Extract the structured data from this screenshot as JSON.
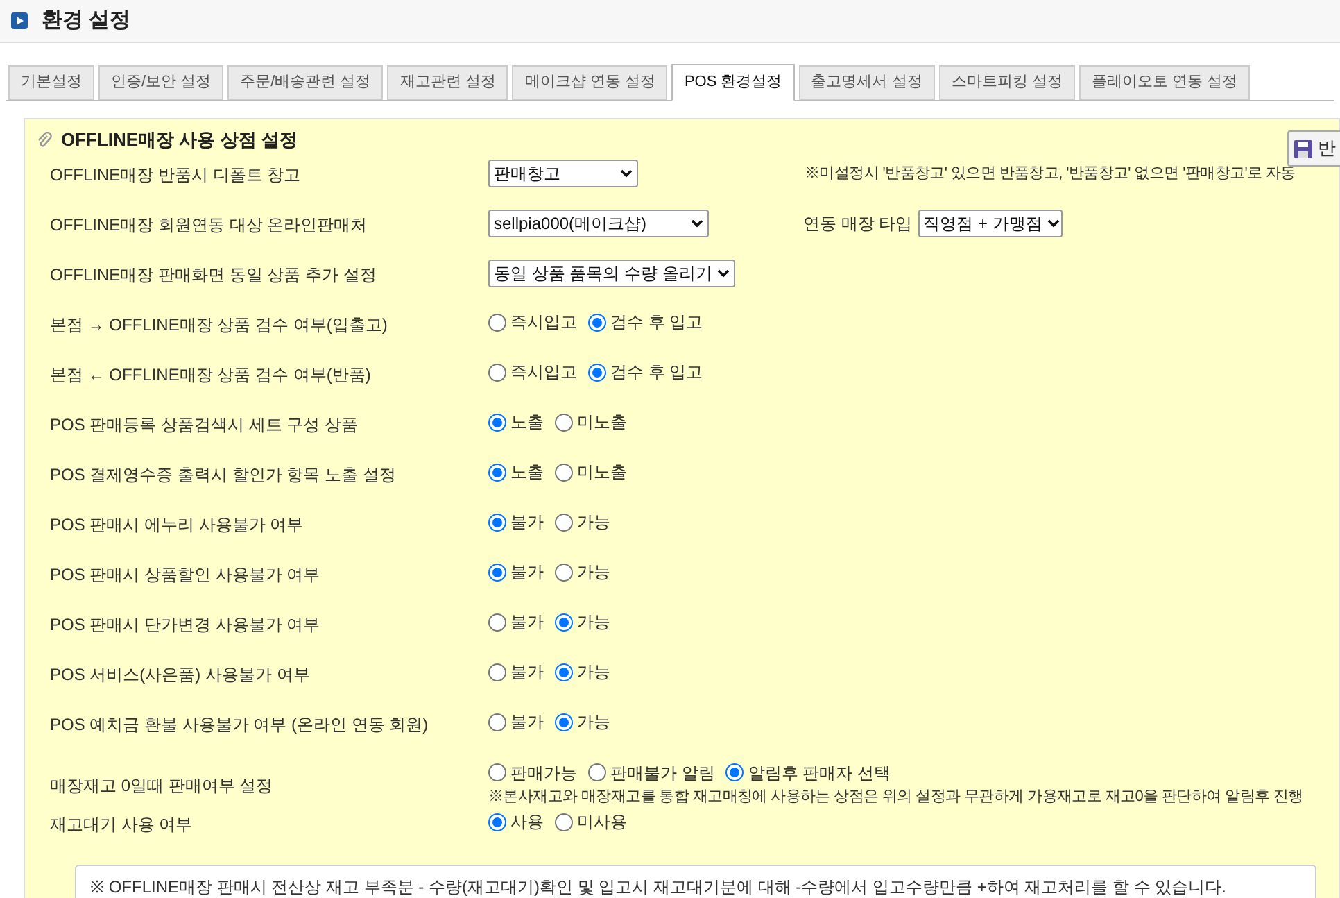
{
  "page_title": "환경 설정",
  "tabs": [
    {
      "label": "기본설정",
      "selected": false
    },
    {
      "label": "인증/보안 설정",
      "selected": false
    },
    {
      "label": "주문/배송관련 설정",
      "selected": false
    },
    {
      "label": "재고관련 설정",
      "selected": false
    },
    {
      "label": "메이크샵 연동 설정",
      "selected": false
    },
    {
      "label": "POS 환경설정",
      "selected": true
    },
    {
      "label": "출고명세서 설정",
      "selected": false
    },
    {
      "label": "스마트피킹 설정",
      "selected": false
    },
    {
      "label": "플레이오토 연동 설정",
      "selected": false
    }
  ],
  "panel": {
    "title": "OFFLINE매장 사용 상점 설정",
    "save_button": "반"
  },
  "settings": [
    {
      "kind": "select",
      "label": "OFFLINE매장 반품시 디폴트 창고",
      "value": "판매창고",
      "note": "※미설정시 '반품창고' 있으면 반품창고, '반품창고' 없으면 '판매창고'로 자동"
    },
    {
      "kind": "select",
      "label": "OFFLINE매장 회원연동 대상 온라인판매처",
      "value": "sellpia000(메이크샵)",
      "extra_label": "연동 매장 타입",
      "extra_value": "직영점 + 가맹점"
    },
    {
      "kind": "select",
      "label": "OFFLINE매장 판매화면 동일 상품 추가 설정",
      "value": "동일 상품 품목의 수량 올리기"
    },
    {
      "kind": "radio",
      "label": "본점 → OFFLINE매장 상품 검수 여부(입출고)",
      "options": [
        {
          "label": "즉시입고",
          "selected": false
        },
        {
          "label": "검수 후 입고",
          "selected": true
        }
      ]
    },
    {
      "kind": "radio",
      "label": "본점 ← OFFLINE매장 상품 검수 여부(반품)",
      "options": [
        {
          "label": "즉시입고",
          "selected": false
        },
        {
          "label": "검수 후 입고",
          "selected": true
        }
      ]
    },
    {
      "kind": "radio",
      "label": "POS 판매등록 상품검색시 세트 구성 상품",
      "options": [
        {
          "label": "노출",
          "selected": true
        },
        {
          "label": "미노출",
          "selected": false
        }
      ]
    },
    {
      "kind": "radio",
      "label": "POS 결제영수증 출력시 할인가 항목 노출 설정",
      "options": [
        {
          "label": "노출",
          "selected": true
        },
        {
          "label": "미노출",
          "selected": false
        }
      ]
    },
    {
      "kind": "radio",
      "label": "POS 판매시 에누리 사용불가 여부",
      "options": [
        {
          "label": "불가",
          "selected": true
        },
        {
          "label": "가능",
          "selected": false
        }
      ]
    },
    {
      "kind": "radio",
      "label": "POS 판매시 상품할인 사용불가 여부",
      "options": [
        {
          "label": "불가",
          "selected": true
        },
        {
          "label": "가능",
          "selected": false
        }
      ]
    },
    {
      "kind": "radio",
      "label": "POS 판매시 단가변경 사용불가 여부",
      "options": [
        {
          "label": "불가",
          "selected": false
        },
        {
          "label": "가능",
          "selected": true
        }
      ]
    },
    {
      "kind": "radio",
      "label": "POS 서비스(사은품) 사용불가 여부",
      "options": [
        {
          "label": "불가",
          "selected": false
        },
        {
          "label": "가능",
          "selected": true
        }
      ]
    },
    {
      "kind": "radio",
      "label": "POS 예치금 환불 사용불가 여부 (온라인 연동 회원)",
      "options": [
        {
          "label": "불가",
          "selected": false
        },
        {
          "label": "가능",
          "selected": true
        }
      ]
    },
    {
      "kind": "radio",
      "label": "매장재고 0일때 판매여부 설정",
      "options": [
        {
          "label": "판매가능",
          "selected": false
        },
        {
          "label": "판매불가 알림",
          "selected": false
        },
        {
          "label": "알림후 판매자 선택",
          "selected": true
        }
      ],
      "note": "※본사재고와 매장재고를 통합 재고매칭에 사용하는 상점은 위의 설정과 무관하게 가용재고로 재고0을 판단하여 알림후 진행"
    },
    {
      "kind": "radio",
      "label": "재고대기 사용 여부",
      "options": [
        {
          "label": "사용",
          "selected": true
        },
        {
          "label": "미사용",
          "selected": false
        }
      ]
    }
  ],
  "info_box": "※ OFFLINE매장 판매시 전산상 재고 부족분 - 수량(재고대기)확인 및 입고시 재고대기분에 대해 -수량에서 입고수량만큼 +하여 재고처리를 할 수 있습니다."
}
